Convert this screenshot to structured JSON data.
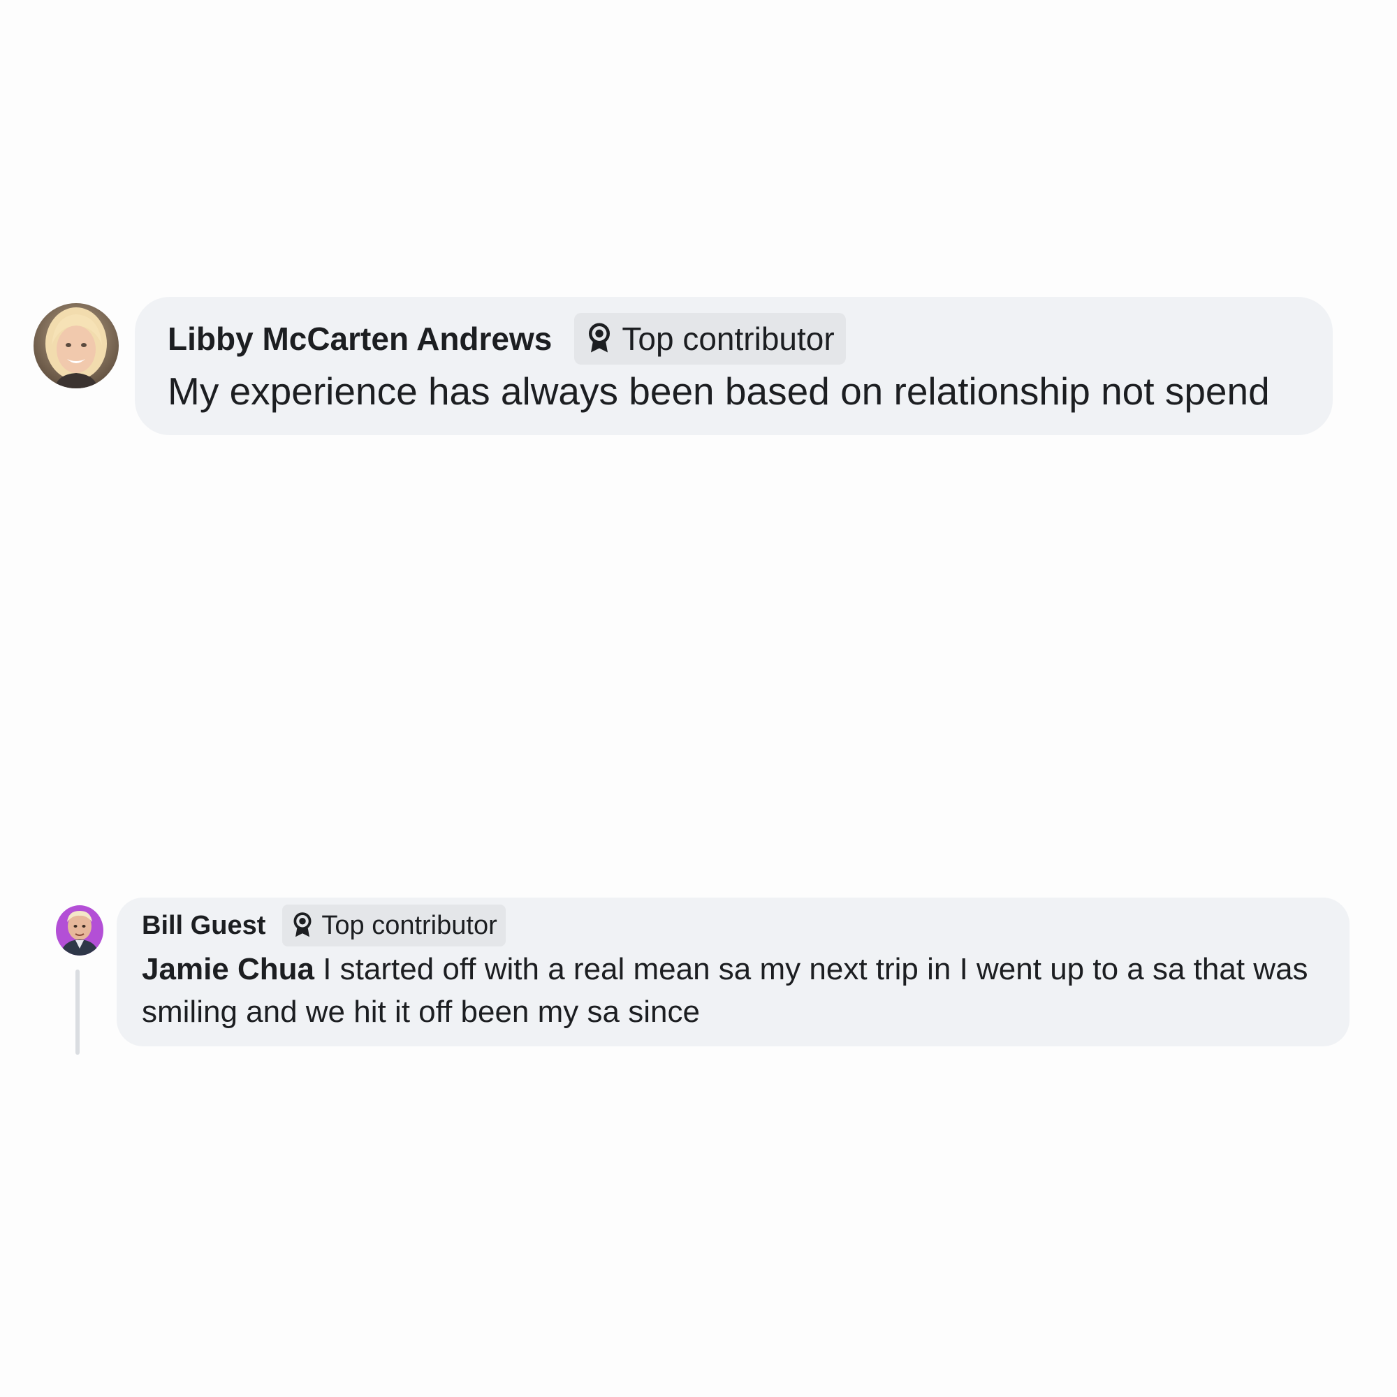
{
  "comments": [
    {
      "author": "Libby McCarten Andrews",
      "badge": "Top contributor",
      "badge_icon": "award-ribbon-icon",
      "text": "My experience has always been based on relationship not spend"
    },
    {
      "author": "Bill Guest",
      "badge": "Top contributor",
      "badge_icon": "award-ribbon-icon",
      "mention": "Jamie Chua",
      "text": "I started off with a real mean sa my next trip in I went up to a sa that was smiling and we hit it off been my sa since"
    }
  ],
  "colors": {
    "bubble": "#f0f2f5",
    "badge": "#e4e6e9",
    "text": "#1c1e21",
    "thread_line": "#dadde1"
  }
}
